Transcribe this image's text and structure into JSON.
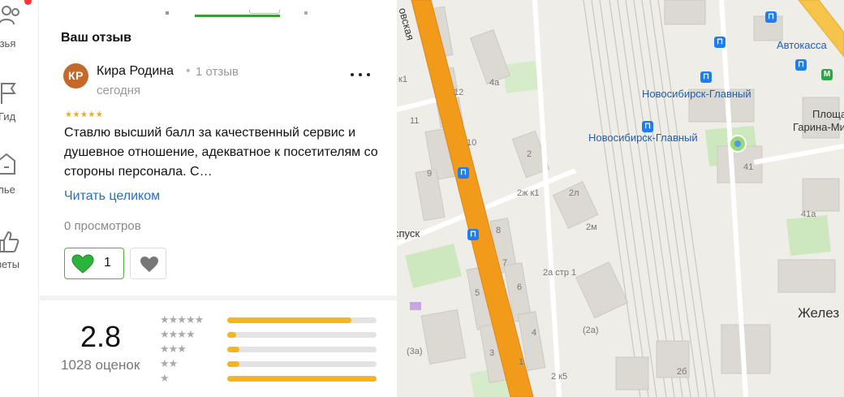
{
  "nav": {
    "items": [
      {
        "label": "рузья",
        "icon": "friends-icon"
      },
      {
        "label": "Гид",
        "icon": "guide-flag-icon"
      },
      {
        "label": "илье",
        "icon": "housing-icon"
      },
      {
        "label": "оветы",
        "icon": "thumbs-up-icon"
      }
    ],
    "notification_dot_color": "#ff3333"
  },
  "review": {
    "section_title": "Ваш отзыв",
    "avatar_initials": "КР",
    "avatar_color": "#c5692a",
    "author_name": "Кира Родина",
    "author_separator": "•",
    "author_review_count": "1 отзыв",
    "date": "сегодня",
    "more_icon": "more-horizontal-icon",
    "stars": "★★★★★",
    "rating_value": 5,
    "text": "Ставлю высший балл за качественный сервис и душевное отношение, адекватное к посетителям со стороны персонала. С…",
    "read_more_label": "Читать целиком",
    "views_label": "0 просмотров",
    "like_icon": "green-heart-icon",
    "like_count": "1",
    "dislike_icon": "heart-icon"
  },
  "rating_summary": {
    "average": "2.8",
    "count_label": "1028 оценок",
    "distribution": [
      {
        "stars": "★★★★★",
        "fraction": 0.83
      },
      {
        "stars": "★★★★",
        "fraction": 0.06
      },
      {
        "stars": "★★★",
        "fraction": 0.08
      },
      {
        "stars": "★★",
        "fraction": 0.08
      },
      {
        "stars": "★",
        "fraction": 1.0
      }
    ],
    "bar_color": "#f6b51c"
  },
  "map": {
    "labels": {
      "street_top": "овская",
      "street_spusk": "спуск",
      "avtokassa": "Автокасса",
      "station_1": "Новосибирск-Главный",
      "station_2": "Новосибирск-Главный",
      "square_1": "Площа",
      "square_2": "Гарина-Михай",
      "zhelez": "Желез"
    },
    "house_numbers": [
      "к1",
      "12",
      "11",
      "10",
      "9",
      "4а",
      "2",
      "2ж к1",
      "2л",
      "2м",
      "8",
      "7",
      "6",
      "5",
      "4",
      "3",
      "2а стр 1",
      "(2а)",
      "(3а)",
      "2 к5",
      "2б",
      "41",
      "41а",
      "1"
    ]
  }
}
